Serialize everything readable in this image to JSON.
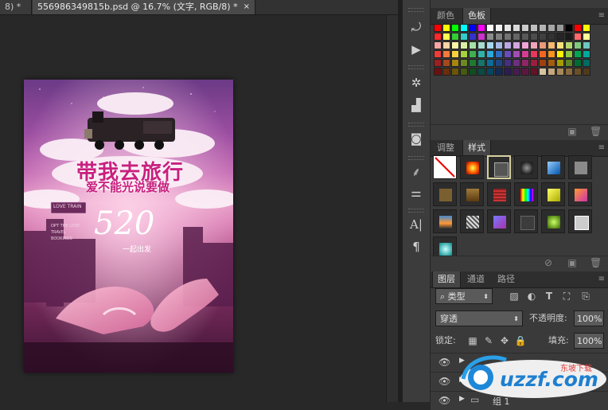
{
  "tabs": {
    "prev_tab": "8) *",
    "active_tab": "556986349815b.psd @ 16.7% (文字, RGB/8) *",
    "close_glyph": "×"
  },
  "document": {
    "headline": "带我去旅行",
    "subline": "爱不能光说要做",
    "big_number": "520",
    "caption": "一起出发",
    "sign_text": "LOVE TRAIN",
    "side_text": "OPT THE LOVE TRAVEL BOOKINGS"
  },
  "swatch_panel": {
    "tab_color": "颜色",
    "tab_swatches": "色板",
    "colors": [
      "#ff0000",
      "#ffff00",
      "#00ff00",
      "#00ffff",
      "#0000ff",
      "#ff00ff",
      "#ffffff",
      "#f2f2f2",
      "#e6e6e6",
      "#d9d9d9",
      "#cccccc",
      "#bfbfbf",
      "#b3b3b3",
      "#a6a6a6",
      "#999999",
      "#000000",
      "#ff0000",
      "#ffff00",
      "#ff2a2a",
      "#ffff55",
      "#33cc33",
      "#33cccc",
      "#3333cc",
      "#cc33cc",
      "#8c8c8c",
      "#808080",
      "#737373",
      "#666666",
      "#595959",
      "#4d4d4d",
      "#404040",
      "#333333",
      "#262626",
      "#1a1a1a",
      "#ff6a6a",
      "#ffff99",
      "#f7a6a6",
      "#f9d3a6",
      "#fbf5a6",
      "#d9f0a6",
      "#a6e0a6",
      "#a6dcd0",
      "#a6d7f0",
      "#a6b8e6",
      "#b8a6e0",
      "#d3a6e0",
      "#f0a6d7",
      "#f0a6b8",
      "#e89a7a",
      "#f5b971",
      "#f7e27a",
      "#b5d86e",
      "#7fc97f",
      "#6fc5c0",
      "#ee3b3b",
      "#f37b3d",
      "#f8d03f",
      "#a4d13c",
      "#3fb04f",
      "#30b3a6",
      "#2ea7dd",
      "#2e6bc4",
      "#6a4cb6",
      "#a34cb6",
      "#d63c93",
      "#e5395d",
      "#f26522",
      "#f7941d",
      "#fff200",
      "#8dc63f",
      "#00a651",
      "#00a99d",
      "#9e1f1f",
      "#a6481a",
      "#a8850f",
      "#6b8a1f",
      "#1e7a31",
      "#15756b",
      "#0b6c9c",
      "#1c4585",
      "#442f80",
      "#6e2f80",
      "#8f2566",
      "#9b1e3d",
      "#a33f0f",
      "#a65c0f",
      "#a69b00",
      "#5c8526",
      "#006b33",
      "#006b63",
      "#6b1010",
      "#6b2e0c",
      "#6b5508",
      "#455a13",
      "#114d1f",
      "#0c4a44",
      "#064563",
      "#112b55",
      "#2b1d52",
      "#461d52",
      "#5c1741",
      "#631227",
      "#d5c4a1",
      "#c6a87c",
      "#a8895a",
      "#8a6a3c",
      "#6b4f27",
      "#4f3a1c"
    ]
  },
  "styles_panel": {
    "tab_adjust": "调整",
    "tab_styles": "样式"
  },
  "layers_panel": {
    "tab_layers": "图层",
    "tab_channels": "通道",
    "tab_paths": "路径",
    "filter_kind": "类型",
    "blend_mode": "穿透",
    "opacity_label": "不透明度:",
    "opacity_value": "100%",
    "lock_label": "锁定:",
    "fill_label": "填充:",
    "fill_value": "100%",
    "group_label": "组 1"
  },
  "watermark": {
    "brand": "uzzf.com",
    "tagline": "东坡下载"
  },
  "icons": {
    "panel_menu": "panel-menu-icon",
    "eye": "eye-icon",
    "new_swatch": "new-icon",
    "delete": "trash-icon",
    "folder": "folder-icon"
  }
}
